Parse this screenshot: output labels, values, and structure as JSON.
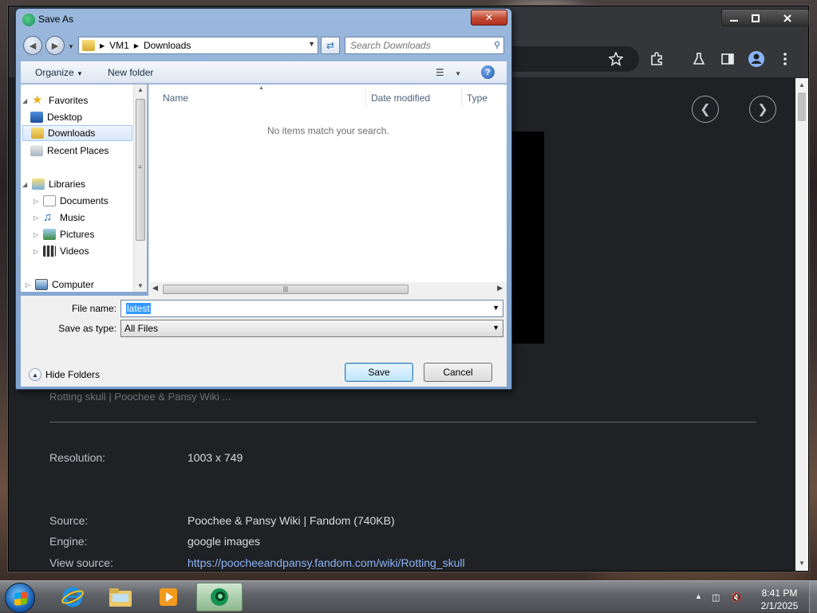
{
  "dialog": {
    "title": "Save As",
    "address": {
      "root": "VM1",
      "folder": "Downloads"
    },
    "search_placeholder": "Search Downloads",
    "toolbar": {
      "organize": "Organize",
      "new_folder": "New folder",
      "help": "?"
    },
    "nav": {
      "favorites": "Favorites",
      "desktop": "Desktop",
      "downloads": "Downloads",
      "recent": "Recent Places",
      "libraries": "Libraries",
      "documents": "Documents",
      "music": "Music",
      "pictures": "Pictures",
      "videos": "Videos",
      "computer": "Computer"
    },
    "columns": {
      "name": "Name",
      "date": "Date modified",
      "type": "Type"
    },
    "empty_message": "No items match your search.",
    "file_name_label": "File name:",
    "file_name": "latest",
    "save_type_label": "Save as type:",
    "save_type": "All Files",
    "hide_folders": "Hide Folders",
    "save": "Save",
    "cancel": "Cancel"
  },
  "page": {
    "faded_title": "Rotting skull | Poochee & Pansy Wiki ...",
    "info": {
      "resolution_label": "Resolution:",
      "resolution": "1003 x 749",
      "source_label": "Source:",
      "source": "Poochee & Pansy Wiki | Fandom (740KB)",
      "engine_label": "Engine:",
      "engine": "google images",
      "view_source_label": "View source:",
      "view_source": "https://poocheeandpansy.fandom.com/wiki/Rotting_skull"
    }
  },
  "taskbar": {
    "time": "8:41 PM",
    "date": "2/1/2025"
  },
  "colors": {
    "browser_bg": "#202124",
    "link": "#8ab4f8",
    "selection": "#3399ff"
  }
}
